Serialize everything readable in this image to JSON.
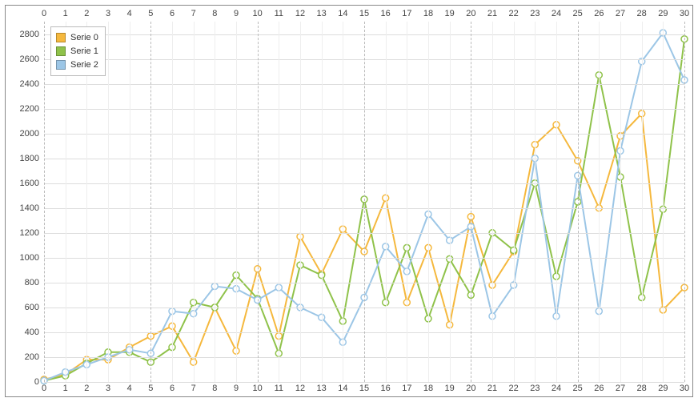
{
  "chart_data": {
    "type": "line",
    "title": "",
    "xlabel": "",
    "ylabel": "",
    "xlim": [
      0,
      30
    ],
    "ylim": [
      0,
      2900
    ],
    "x_ticks": [
      0,
      1,
      2,
      3,
      4,
      5,
      6,
      7,
      8,
      9,
      10,
      11,
      12,
      13,
      14,
      15,
      16,
      17,
      18,
      19,
      20,
      21,
      22,
      23,
      24,
      25,
      26,
      27,
      28,
      29,
      30
    ],
    "y_ticks": [
      0,
      200,
      400,
      600,
      800,
      1000,
      1200,
      1400,
      1600,
      1800,
      2000,
      2200,
      2400,
      2600,
      2800
    ],
    "x_major_gridlines": [
      0,
      5,
      10,
      15,
      20,
      25,
      30
    ],
    "top_axis": true,
    "categories": [
      0,
      1,
      2,
      3,
      4,
      5,
      6,
      7,
      8,
      9,
      10,
      11,
      12,
      13,
      14,
      15,
      16,
      17,
      18,
      19,
      20,
      21,
      22,
      23,
      24,
      25,
      26,
      27,
      28,
      29,
      30
    ],
    "series": [
      {
        "name": "Serie 0",
        "color": "#f5b83d",
        "values": [
          20,
          60,
          180,
          180,
          280,
          370,
          450,
          160,
          600,
          250,
          910,
          370,
          1170,
          870,
          1230,
          1050,
          1480,
          640,
          1080,
          460,
          1330,
          780,
          1050,
          1910,
          2070,
          1780,
          1400,
          1980,
          2160,
          580,
          760
        ]
      },
      {
        "name": "Serie 1",
        "color": "#8fc24a",
        "values": [
          10,
          50,
          150,
          240,
          240,
          160,
          280,
          640,
          600,
          860,
          670,
          230,
          940,
          860,
          490,
          1470,
          640,
          1080,
          510,
          990,
          700,
          1200,
          1060,
          1600,
          850,
          1450,
          2470,
          1650,
          680,
          1390,
          2760
        ]
      },
      {
        "name": "Serie 2",
        "color": "#9cc6e6",
        "values": [
          10,
          80,
          140,
          200,
          260,
          230,
          570,
          550,
          770,
          750,
          660,
          760,
          600,
          520,
          320,
          680,
          1090,
          890,
          1350,
          1140,
          1250,
          530,
          780,
          1800,
          530,
          1660,
          570,
          1860,
          2580,
          2810,
          2430
        ]
      }
    ],
    "legend": {
      "position": "top-left",
      "entries": [
        "Serie 0",
        "Serie 1",
        "Serie 2"
      ]
    }
  }
}
